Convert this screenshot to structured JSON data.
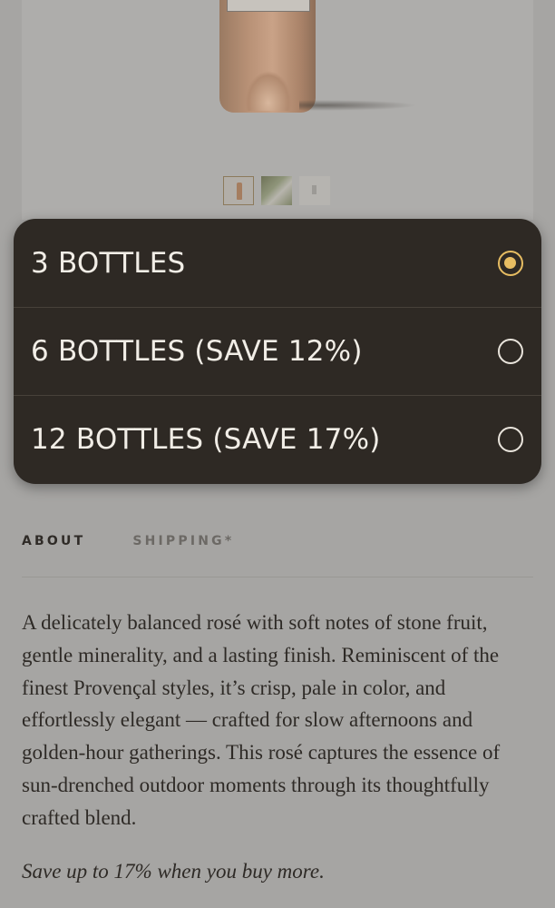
{
  "product_gallery": {
    "thumbnails": [
      "bottle-thumbnail",
      "lifestyle-thumbnail",
      "label-thumbnail"
    ],
    "selected_thumbnail": 0
  },
  "quantity_options": [
    {
      "label": "3 BOTTLES",
      "selected": true
    },
    {
      "label": "6 BOTTLES (SAVE 12%)",
      "selected": false
    },
    {
      "label": "12 BOTTLES (SAVE 17%)",
      "selected": false
    }
  ],
  "colors": {
    "accent": "#e7bd62",
    "sheet_background": "#2e2924",
    "page_background": "#a6a5a3"
  },
  "tabs": [
    {
      "label": "ABOUT",
      "active": true
    },
    {
      "label": "SHIPPING*",
      "active": false
    }
  ],
  "about": {
    "description": "A delicately balanced rosé with soft notes of stone fruit, gentle minerality, and a lasting finish. Reminiscent of the finest Provençal styles, it’s crisp, pale in color, and effortlessly elegant — crafted for slow afternoons and golden-hour gatherings. This rosé captures the essence of sun-drenched outdoor moments through its thoughtfully crafted blend.",
    "promo": "Save up to 17% when you buy more."
  }
}
